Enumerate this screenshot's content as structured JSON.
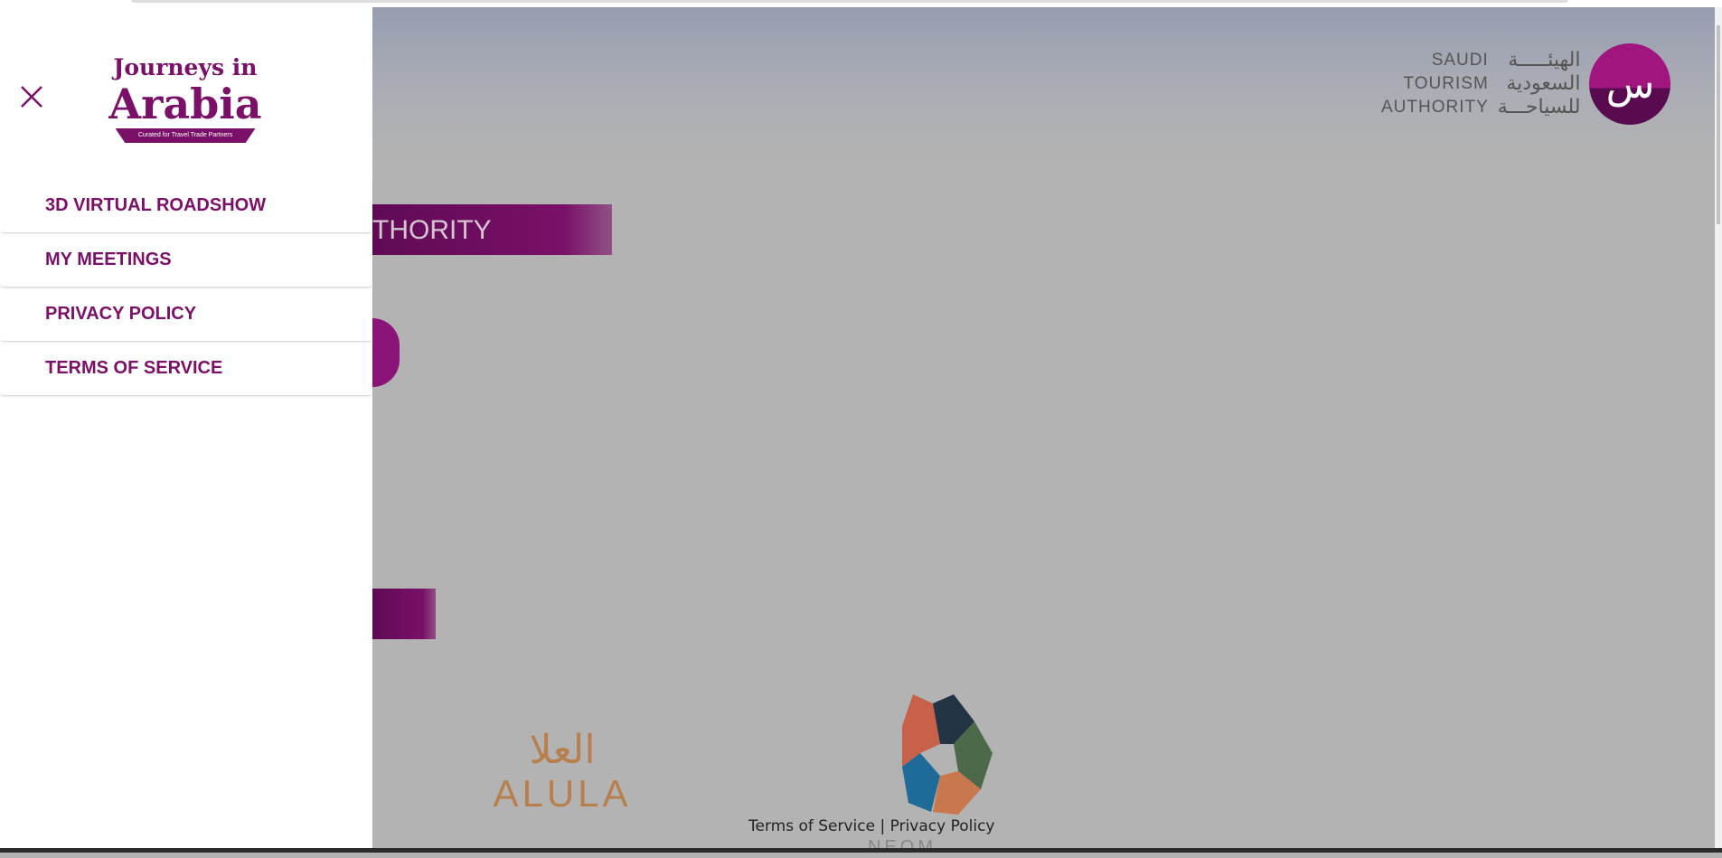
{
  "drawer": {
    "logo": {
      "line1": "Journeys in",
      "line2": "Arabia",
      "tagline": "Curated for Travel Trade Partners"
    },
    "menu": [
      {
        "label": "3D VIRTUAL ROADSHOW"
      },
      {
        "label": "MY MEETINGS"
      },
      {
        "label": "PRIVACY POLICY"
      },
      {
        "label": "TERMS OF SERVICE"
      }
    ]
  },
  "background": {
    "sta_logo": {
      "en1": "SAUDI",
      "en2": "TOURISM",
      "en3": "AUTHORITY",
      "ar1": "الهيئـــــة",
      "ar2": "السعودية",
      "ar3": "للسياحـــة",
      "mark": "س"
    },
    "banner_text": "THORITY",
    "alula": {
      "ar": "العلا",
      "en": "ALULA"
    },
    "neom": "NEOM",
    "footer": {
      "terms": "Terms of Service",
      "separator": "|",
      "privacy": "Privacy Policy"
    }
  },
  "colors": {
    "brand": "#7b1068",
    "backdrop": "#b3b3b3"
  }
}
